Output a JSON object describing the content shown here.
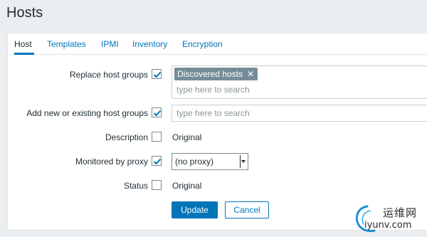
{
  "header": {
    "title": "Hosts"
  },
  "tabs": [
    {
      "label": "Host",
      "active": true
    },
    {
      "label": "Templates",
      "active": false
    },
    {
      "label": "IPMI",
      "active": false
    },
    {
      "label": "Inventory",
      "active": false
    },
    {
      "label": "Encryption",
      "active": false
    }
  ],
  "form": {
    "replace_host_groups": {
      "label": "Replace host groups",
      "checked": true,
      "tag": "Discovered hosts",
      "tag_remove_glyph": "✕",
      "placeholder": "type here to search"
    },
    "add_host_groups": {
      "label": "Add new or existing host groups",
      "checked": true,
      "placeholder": "type here to search"
    },
    "description": {
      "label": "Description",
      "checked": false,
      "value": "Original"
    },
    "monitored_by_proxy": {
      "label": "Monitored by proxy",
      "checked": true,
      "selected": "(no proxy)"
    },
    "status": {
      "label": "Status",
      "checked": false,
      "value": "Original"
    }
  },
  "actions": {
    "update_label": "Update",
    "cancel_label": "Cancel"
  },
  "watermark": {
    "cn": "运维网",
    "en": "iyunv.com"
  },
  "colors": {
    "accent": "#0275b8",
    "tag_bg": "#768d99",
    "page_bg": "#ebeef0"
  }
}
